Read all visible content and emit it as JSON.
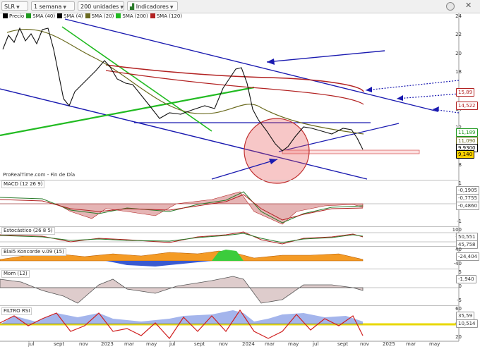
{
  "toolbar": {
    "symbol": "SLR",
    "period": "1 semana",
    "units": "200 unidades",
    "indicators": "Indicadores"
  },
  "legend": [
    {
      "label": "Precio",
      "color": "#000000"
    },
    {
      "label": "SMA (40)",
      "color": "#1f9a1f"
    },
    {
      "label": "SMA (4)",
      "color": "#000000"
    },
    {
      "label": "SMA (20)",
      "color": "#6b6b1f"
    },
    {
      "label": "SMA (200)",
      "color": "#22bb22"
    },
    {
      "label": "SMA (120)",
      "color": "#b22222"
    }
  ],
  "credit": "ProRealTime.com - Fin de Día",
  "price_axis": {
    "ticks": [
      "24",
      "22",
      "20",
      "18",
      "16",
      "14",
      "12",
      "10",
      "8"
    ],
    "tags": [
      {
        "value": "15,89",
        "color": "#b22222",
        "bg": "#ffffff"
      },
      {
        "value": "14,522",
        "color": "#b22222",
        "bg": "#ffffff"
      },
      {
        "value": "11,189",
        "color": "#1f9a1f",
        "bg": "#ffffff"
      },
      {
        "value": "11,090",
        "color": "#6b6b1f",
        "bg": "#ffffff"
      },
      {
        "value": "9,9300",
        "color": "#000000",
        "bg": "#ffffff"
      },
      {
        "value": "9,140",
        "color": "#000000",
        "bg": "#ffd200"
      }
    ]
  },
  "panels": {
    "macd": {
      "title": "MACD (12 26 9)",
      "ticks": [
        "1",
        "0",
        "-1"
      ],
      "tags": [
        "-0,1905",
        "-0,7755",
        "-0,4860"
      ]
    },
    "stoch": {
      "title": "Estocástico (26 8 5)",
      "ticks": [
        "100",
        "50",
        "0"
      ],
      "tags": [
        "50,551",
        "45,758"
      ]
    },
    "blai5": {
      "title": "Blai5 Koncorde v.09 (15)",
      "ticks": [
        "40",
        "0",
        "-40"
      ],
      "tags": [
        "-24,404"
      ]
    },
    "mom": {
      "title": "Mom (12)",
      "ticks": [
        "5",
        "0",
        "-5"
      ],
      "tags": [
        "-1,940"
      ]
    },
    "rsi": {
      "title": "FILTRO RSI",
      "ticks": [
        "60",
        "40",
        "20"
      ],
      "tags": [
        "35,59",
        "10,514"
      ]
    }
  },
  "x_axis": [
    "jul",
    "sept",
    "nov",
    "2023",
    "mar",
    "may",
    "jul",
    "sept",
    "nov",
    "2024",
    "mar",
    "may",
    "jul",
    "sept",
    "nov",
    "2025",
    "mar",
    "may"
  ],
  "colors": {
    "channel": "#1a1ab0",
    "sma200": "#22bb22",
    "sma120": "#b22222",
    "sma40": "#1f9a1f",
    "sma20": "#6b6b1f",
    "support": "#f4a6a6"
  }
}
